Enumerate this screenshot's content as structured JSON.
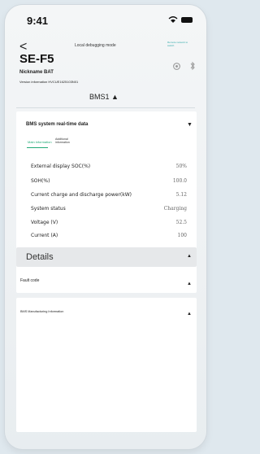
{
  "status_bar": {
    "time": "9:41"
  },
  "header": {
    "mode_text": "Local debugging mode",
    "link_text": "Remote network to switch",
    "title": "SE-F5",
    "nickname": "Nickname BAT",
    "version_info": "Version information HVCUE1625103N01"
  },
  "selector": {
    "bms": "BMS1 ▲"
  },
  "realtime": {
    "title": "BMS system real-time data",
    "tabs": [
      "Main information",
      "Additional information"
    ],
    "rows": [
      {
        "label": "External display SOC(%)",
        "value": "50%"
      },
      {
        "label": "SOH(%)",
        "value": "100.0"
      },
      {
        "label": "Current charge and discharge power(kW)",
        "value": "5.12"
      },
      {
        "label": "System status",
        "value": "Charging"
      },
      {
        "label": "Voltage (V)",
        "value": "52.5"
      },
      {
        "label": "Current (A)",
        "value": "100"
      }
    ]
  },
  "details": {
    "label": "Details"
  },
  "fault": {
    "label": "Fault code"
  },
  "manufacturing": {
    "label": "BMS Manufacturing Information"
  },
  "icons": [
    "back-icon",
    "wifi-icon",
    "battery-icon",
    "gear-icon",
    "bluetooth-icon",
    "caret-down-icon",
    "caret-up-icon"
  ]
}
